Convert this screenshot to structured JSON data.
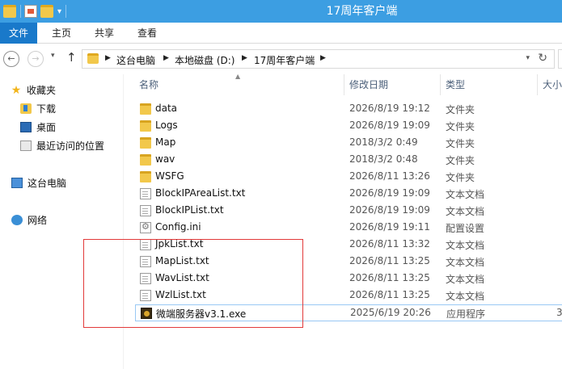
{
  "window": {
    "title": "17周年客户端",
    "accent": "#3c9ee2"
  },
  "ribbon": {
    "file": "文件",
    "tabs": [
      "主页",
      "共享",
      "查看"
    ]
  },
  "address": {
    "crumbs": [
      "这台电脑",
      "本地磁盘 (D:)",
      "17周年客户端"
    ]
  },
  "navpane": {
    "quick_access": "收藏夹",
    "downloads": "下载",
    "desktop": "桌面",
    "recent": "最近访问的位置",
    "this_pc": "这台电脑",
    "network": "网络"
  },
  "columns": {
    "name": "名称",
    "date": "修改日期",
    "type": "类型",
    "size": "大小"
  },
  "files": [
    {
      "name": "data",
      "date": "2026/8/19 19:12",
      "type": "文件夹",
      "size": "",
      "icon": "folder-icon"
    },
    {
      "name": "Logs",
      "date": "2026/8/19 19:09",
      "type": "文件夹",
      "size": "",
      "icon": "folder-icon"
    },
    {
      "name": "Map",
      "date": "2018/3/2 0:49",
      "type": "文件夹",
      "size": "",
      "icon": "folder-icon"
    },
    {
      "name": "wav",
      "date": "2018/3/2 0:48",
      "type": "文件夹",
      "size": "",
      "icon": "folder-icon"
    },
    {
      "name": "WSFG",
      "date": "2026/8/11 13:26",
      "type": "文件夹",
      "size": "",
      "icon": "folder-icon"
    },
    {
      "name": "BlockIPAreaList.txt",
      "date": "2026/8/19 19:09",
      "type": "文本文档",
      "size": "",
      "icon": "text-file-icon"
    },
    {
      "name": "BlockIPList.txt",
      "date": "2026/8/19 19:09",
      "type": "文本文档",
      "size": "",
      "icon": "text-file-icon"
    },
    {
      "name": "Config.ini",
      "date": "2026/8/19 19:11",
      "type": "配置设置",
      "size": "",
      "icon": "config-file-icon"
    },
    {
      "name": "JpkList.txt",
      "date": "2026/8/11 13:32",
      "type": "文本文档",
      "size": "",
      "icon": "text-file-icon"
    },
    {
      "name": "MapList.txt",
      "date": "2026/8/11 13:25",
      "type": "文本文档",
      "size": "",
      "icon": "text-file-icon"
    },
    {
      "name": "WavList.txt",
      "date": "2026/8/11 13:25",
      "type": "文本文档",
      "size": "",
      "icon": "text-file-icon"
    },
    {
      "name": "WzlList.txt",
      "date": "2026/8/11 13:25",
      "type": "文本文档",
      "size": "",
      "icon": "text-file-icon"
    },
    {
      "name": "微端服务器v3.1.exe",
      "date": "2025/6/19 20:26",
      "type": "应用程序",
      "size": "3,",
      "icon": "application-icon"
    }
  ]
}
